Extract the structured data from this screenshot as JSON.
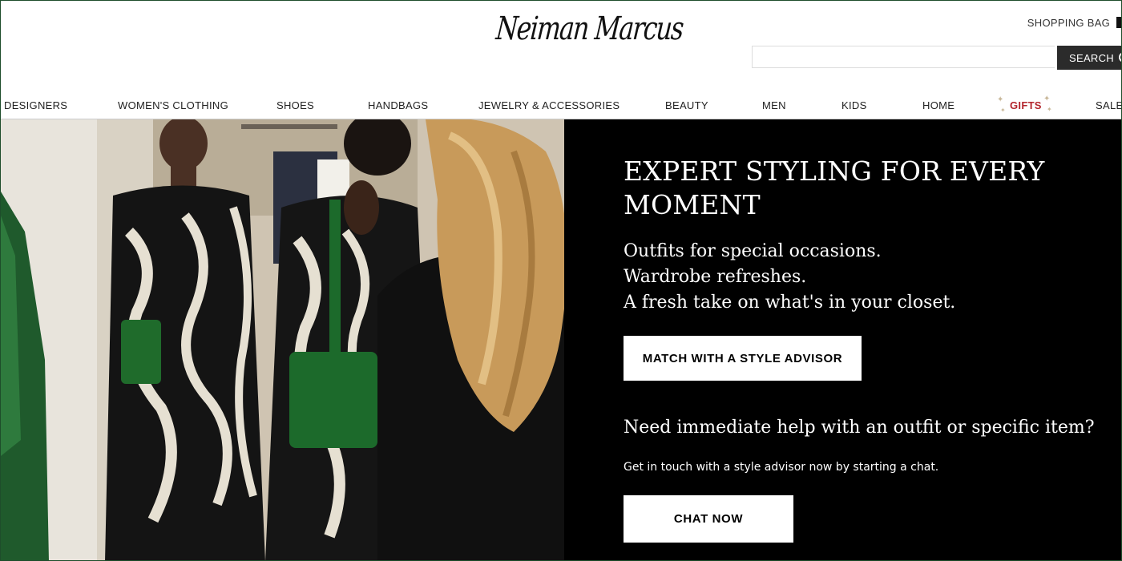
{
  "brand": {
    "logo_text": "Neiman Marcus"
  },
  "header": {
    "shopping_bag_label": "SHOPPING BAG",
    "search_placeholder": "",
    "search_button_label": "SEARCH"
  },
  "nav": {
    "items": [
      {
        "label": "DESIGNERS"
      },
      {
        "label": "WOMEN'S CLOTHING"
      },
      {
        "label": "SHOES"
      },
      {
        "label": "HANDBAGS"
      },
      {
        "label": "JEWELRY & ACCESSORIES"
      },
      {
        "label": "BEAUTY"
      },
      {
        "label": "MEN"
      },
      {
        "label": "KIDS"
      },
      {
        "label": "HOME"
      },
      {
        "label": "GIFTS"
      },
      {
        "label": "SALE"
      }
    ]
  },
  "hero": {
    "title": "EXPERT STYLING FOR EVERY MOMENT",
    "lines": [
      "Outfits for special occasions.",
      "Wardrobe refreshes.",
      "A fresh take on what's in your closet."
    ],
    "cta_label": "MATCH WITH A STYLE ADVISOR",
    "help_heading": "Need immediate help with an outfit or specific item?",
    "help_text": "Get in touch with a style advisor now by starting a chat.",
    "chat_label": "CHAT NOW"
  },
  "colors": {
    "gifts": "#b3242c",
    "search_button": "#2b2b2b",
    "hero_panel": "#000000",
    "frame_border": "#1e4d2b"
  }
}
